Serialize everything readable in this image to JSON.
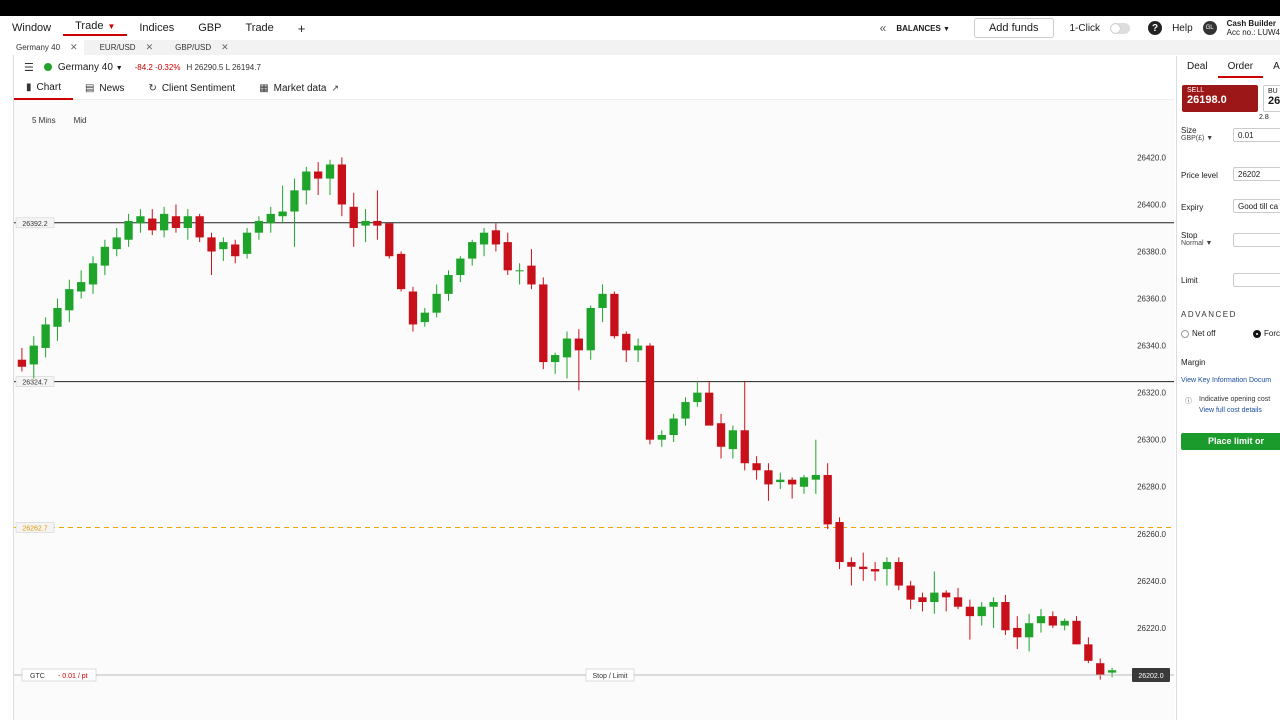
{
  "menu": {
    "items": [
      "Window",
      "Trade",
      "Indices",
      "GBP",
      "Trade",
      "+"
    ],
    "balances": "BALANCES",
    "add_funds": "Add funds",
    "one_click": "1-Click",
    "help": "Help",
    "account_name": "Cash Builder",
    "account_no": "Acc no.: LUW4"
  },
  "tabs": [
    {
      "label": "Germany 40"
    },
    {
      "label": "EUR/USD"
    },
    {
      "label": "GBP/USD"
    }
  ],
  "instrument": {
    "name": "Germany 40",
    "change": "-84.2",
    "change_pct": "-0.32%",
    "high_low": "H 26290.5  L 26194.7"
  },
  "subtabs": [
    "Chart",
    "News",
    "Client Sentiment",
    "Market data"
  ],
  "chart": {
    "interval": "5 Mins",
    "price_type": "Mid",
    "gtc_label": "GTC",
    "per_point": "- 0.01 / pt",
    "stop_limit": "Stop / Limit"
  },
  "chart_data": {
    "type": "candlestick",
    "ylim": [
      26197,
      26424
    ],
    "yticks": [
      "26420.0",
      "26400.0",
      "26380.0",
      "26360.0",
      "26340.0",
      "26320.0",
      "26300.0",
      "26280.0",
      "26260.0",
      "26240.0",
      "26220.0"
    ],
    "ytick_values": [
      26420,
      26400,
      26380,
      26360,
      26340,
      26320,
      26300,
      26280,
      26260,
      26240,
      26220
    ],
    "hlines": [
      {
        "value": 26392.2,
        "label": "26392.2",
        "style": "solid",
        "color": "#222222"
      },
      {
        "value": 26324.7,
        "label": "26324.7",
        "style": "solid",
        "color": "#222222"
      },
      {
        "value": 26262.7,
        "label": "26262.7",
        "style": "dashed",
        "color": "#f0a500"
      }
    ],
    "current_price": "26202.0",
    "candles": [
      [
        26334,
        26339,
        26329,
        26331
      ],
      [
        26332,
        26344,
        26326,
        26340
      ],
      [
        26339,
        26352,
        26335,
        26349
      ],
      [
        26348,
        26360,
        26342,
        26356
      ],
      [
        26355,
        26368,
        26350,
        26364
      ],
      [
        26363,
        26372,
        26360,
        26367
      ],
      [
        26366,
        26378,
        26362,
        26375
      ],
      [
        26374,
        26385,
        26370,
        26382
      ],
      [
        26381,
        26390,
        26378,
        26386
      ],
      [
        26385,
        26396,
        26382,
        26393
      ],
      [
        26392,
        26398,
        26388,
        26395
      ],
      [
        26394,
        26398,
        26387,
        26389
      ],
      [
        26389,
        26399,
        26386,
        26396
      ],
      [
        26395,
        26400,
        26388,
        26390
      ],
      [
        26390,
        26398,
        26385,
        26395
      ],
      [
        26395,
        26396,
        26384,
        26386
      ],
      [
        26386,
        26388,
        26370,
        26380
      ],
      [
        26381,
        26386,
        26376,
        26384
      ],
      [
        26383,
        26385,
        26375,
        26378
      ],
      [
        26379,
        26390,
        26377,
        26388
      ],
      [
        26388,
        26395,
        26385,
        26393
      ],
      [
        26392,
        26399,
        26388,
        26396
      ],
      [
        26395,
        26408,
        26392,
        26397
      ],
      [
        26397,
        26411,
        26382,
        26406
      ],
      [
        26406,
        26416,
        26400,
        26414
      ],
      [
        26414,
        26418,
        26404,
        26411
      ],
      [
        26411,
        26419,
        26404,
        26417
      ],
      [
        26417,
        26420,
        26395,
        26400
      ],
      [
        26399,
        26405,
        26382,
        26390
      ],
      [
        26391,
        26398,
        26384,
        26393
      ],
      [
        26393,
        26406,
        26385,
        26391
      ],
      [
        26392,
        26392,
        26377,
        26378
      ],
      [
        26379,
        26380,
        26363,
        26364
      ],
      [
        26363,
        26365,
        26346,
        26349
      ],
      [
        26350,
        26356,
        26348,
        26354
      ],
      [
        26354,
        26366,
        26352,
        26362
      ],
      [
        26362,
        26372,
        26359,
        26370
      ],
      [
        26370,
        26378,
        26367,
        26377
      ],
      [
        26377,
        26385,
        26374,
        26384
      ],
      [
        26383,
        26390,
        26378,
        26388
      ],
      [
        26389,
        26392,
        26380,
        26383
      ],
      [
        26384,
        26388,
        26370,
        26372
      ],
      [
        26372,
        26375,
        26366,
        26372
      ],
      [
        26374,
        26381,
        26364,
        26366
      ],
      [
        26366,
        26369,
        26330,
        26333
      ],
      [
        26333,
        26337,
        26328,
        26336
      ],
      [
        26335,
        26346,
        26326,
        26343
      ],
      [
        26343,
        26347,
        26321,
        26338
      ],
      [
        26338,
        26357,
        26334,
        26356
      ],
      [
        26356,
        26366,
        26350,
        26362
      ],
      [
        26362,
        26363,
        26343,
        26344
      ],
      [
        26345,
        26346,
        26333,
        26338
      ],
      [
        26338,
        26343,
        26333,
        26340
      ],
      [
        26340,
        26341,
        26298,
        26300
      ],
      [
        26300,
        26304,
        26297,
        26302
      ],
      [
        26302,
        26311,
        26299,
        26309
      ],
      [
        26309,
        26318,
        26306,
        26316
      ],
      [
        26316,
        26325,
        26314,
        26320
      ],
      [
        26320,
        26325,
        26306,
        26306
      ],
      [
        26307,
        26311,
        26292,
        26297
      ],
      [
        26296,
        26306,
        26292,
        26304
      ],
      [
        26304,
        26325,
        26287,
        26290
      ],
      [
        26290,
        26293,
        26283,
        26287
      ],
      [
        26287,
        26290,
        26274,
        26281
      ],
      [
        26282,
        26286,
        26279,
        26283
      ],
      [
        26283,
        26284,
        26275,
        26281
      ],
      [
        26280,
        26285,
        26277,
        26284
      ],
      [
        26283,
        26300,
        26277,
        26285
      ],
      [
        26285,
        26290,
        26262,
        26264
      ],
      [
        26265,
        26267,
        26245,
        26248
      ],
      [
        26248,
        26250,
        26238,
        26246
      ],
      [
        26246,
        26252,
        26240,
        26245
      ],
      [
        26245,
        26248,
        26240,
        26244
      ],
      [
        26245,
        26250,
        26238,
        26248
      ],
      [
        26248,
        26250,
        26236,
        26238
      ],
      [
        26238,
        26240,
        26228,
        26232
      ],
      [
        26233,
        26235,
        26227,
        26231
      ],
      [
        26231,
        26244,
        26226,
        26235
      ],
      [
        26235,
        26236,
        26227,
        26233
      ],
      [
        26233,
        26237,
        26228,
        26229
      ],
      [
        26229,
        26232,
        26215,
        26225
      ],
      [
        26225,
        26231,
        26221,
        26229
      ],
      [
        26229,
        26233,
        26220,
        26231
      ],
      [
        26231,
        26234,
        26217,
        26219
      ],
      [
        26220,
        26225,
        26211,
        26216
      ],
      [
        26216,
        26226,
        26210,
        26222
      ],
      [
        26222,
        26228,
        26218,
        26225
      ],
      [
        26225,
        26227,
        26220,
        26221
      ],
      [
        26221,
        26224,
        26219,
        26223
      ],
      [
        26223,
        26225,
        26214,
        26213
      ],
      [
        26213,
        26216,
        26205,
        26206
      ],
      [
        26205,
        26207,
        26198,
        26200
      ],
      [
        26201,
        26203,
        26199,
        26202
      ]
    ]
  },
  "order": {
    "tabs": [
      "Deal",
      "Order",
      "Al"
    ],
    "sell_label": "SELL",
    "sell_price": "26198.0",
    "buy_label": "BU",
    "buy_price": "26",
    "spread": "2.8",
    "size_label": "Size",
    "size_currency": "GBP(£)",
    "size_value": "0.01",
    "price_level_label": "Price level",
    "price_level_value": "26202",
    "expiry_label": "Expiry",
    "expiry_value": "Good till ca",
    "stop_label": "Stop",
    "stop_type": "Normal",
    "limit_label": "Limit",
    "advanced_label": "ADVANCED",
    "net_off": "Net off",
    "force": "Forc",
    "margin_label": "Margin",
    "key_info_link": "View Key Information Docum",
    "indicative": "Indicative opening cost",
    "full_cost_link": "View full cost details",
    "place_button": "Place limit or"
  },
  "colors": {
    "up": "#1ea42a",
    "down": "#c8101b",
    "accent": "#c00000",
    "sell_bg": "#9c1717",
    "place_bg": "#1c9b2d"
  }
}
